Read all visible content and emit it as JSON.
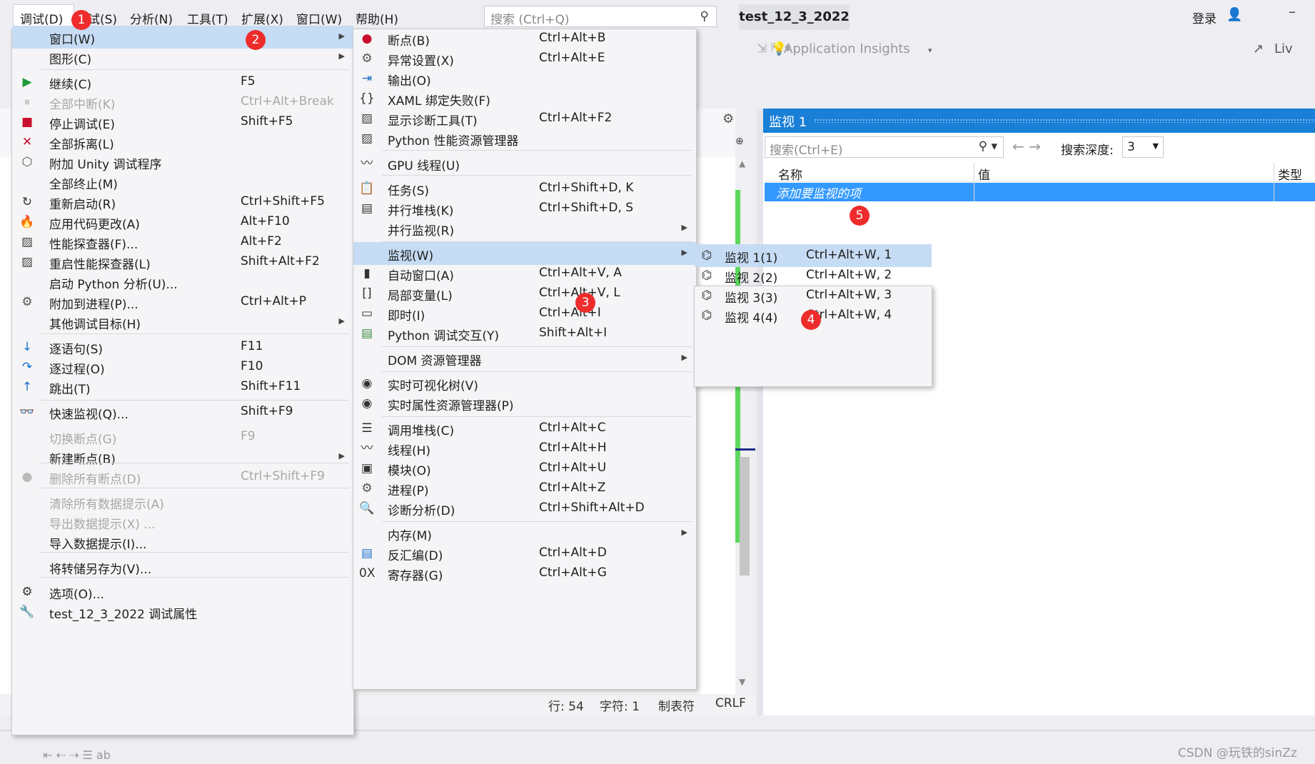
{
  "menubar": {
    "items": [
      "调试(D)",
      "测试(S)",
      "分析(N)",
      "工具(T)",
      "扩展(X)",
      "窗口(W)",
      "帮助(H)"
    ],
    "search_placeholder": "搜索 (Ctrl+Q)",
    "project": "test_12_3_2022",
    "login": "登录"
  },
  "toolbar": {
    "app_insights": "Application Insights",
    "live": "Liv"
  },
  "debug_menu": [
    {
      "label": "窗口(W)",
      "shortcut": "",
      "submenu": true,
      "highlight": true,
      "icon": ""
    },
    {
      "label": "图形(C)",
      "shortcut": "",
      "submenu": true,
      "icon": ""
    },
    {
      "label": "继续(C)",
      "shortcut": "F5",
      "icon": "play-icon"
    },
    {
      "label": "全部中断(K)",
      "shortcut": "Ctrl+Alt+Break",
      "disabled": true,
      "icon": "pause-icon"
    },
    {
      "label": "停止调试(E)",
      "shortcut": "Shift+F5",
      "icon": "stop-icon"
    },
    {
      "label": "全部拆离(L)",
      "shortcut": "",
      "icon": "detach-icon"
    },
    {
      "label": "附加 Unity 调试程序",
      "shortcut": "",
      "icon": "unity-icon"
    },
    {
      "label": "全部终止(M)",
      "shortcut": "",
      "icon": ""
    },
    {
      "label": "重新启动(R)",
      "shortcut": "Ctrl+Shift+F5",
      "icon": "restart-icon"
    },
    {
      "label": "应用代码更改(A)",
      "shortcut": "Alt+F10",
      "icon": "flame-icon"
    },
    {
      "label": "性能探查器(F)...",
      "shortcut": "Alt+F2",
      "icon": "profiler-icon"
    },
    {
      "label": "重启性能探查器(L)",
      "shortcut": "Shift+Alt+F2",
      "icon": "profiler-icon"
    },
    {
      "label": "启动 Python 分析(U)...",
      "shortcut": "",
      "icon": ""
    },
    {
      "label": "附加到进程(P)...",
      "shortcut": "Ctrl+Alt+P",
      "icon": "gears-icon"
    },
    {
      "label": "其他调试目标(H)",
      "shortcut": "",
      "submenu": true,
      "icon": ""
    },
    {
      "label": "逐语句(S)",
      "shortcut": "F11",
      "icon": "step-into-icon"
    },
    {
      "label": "逐过程(O)",
      "shortcut": "F10",
      "icon": "step-over-icon"
    },
    {
      "label": "跳出(T)",
      "shortcut": "Shift+F11",
      "icon": "step-out-icon"
    },
    {
      "label": "快速监视(Q)...",
      "shortcut": "Shift+F9",
      "icon": "glasses-icon"
    },
    {
      "label": "切换断点(G)",
      "shortcut": "F9",
      "disabled": true,
      "icon": ""
    },
    {
      "label": "新建断点(B)",
      "shortcut": "",
      "submenu": true,
      "icon": ""
    },
    {
      "label": "删除所有断点(D)",
      "shortcut": "Ctrl+Shift+F9",
      "disabled": true,
      "icon": "delete-breakpoints-icon"
    },
    {
      "label": "清除所有数据提示(A)",
      "shortcut": "",
      "disabled": true,
      "icon": ""
    },
    {
      "label": "导出数据提示(X) ...",
      "shortcut": "",
      "disabled": true,
      "icon": ""
    },
    {
      "label": "导入数据提示(I)...",
      "shortcut": "",
      "icon": ""
    },
    {
      "label": "将转储另存为(V)...",
      "shortcut": "",
      "icon": ""
    },
    {
      "label": "选项(O)...",
      "shortcut": "",
      "icon": "gear-icon"
    },
    {
      "label": "test_12_3_2022 调试属性",
      "shortcut": "",
      "icon": "wrench-icon"
    }
  ],
  "window_menu": [
    {
      "label": "断点(B)",
      "shortcut": "Ctrl+Alt+B",
      "icon": "breakpoint-icon"
    },
    {
      "label": "异常设置(X)",
      "shortcut": "Ctrl+Alt+E",
      "icon": "exception-icon"
    },
    {
      "label": "输出(O)",
      "shortcut": "",
      "icon": "output-icon"
    },
    {
      "label": "XAML 绑定失败(F)",
      "shortcut": "",
      "icon": "xaml-icon"
    },
    {
      "label": "显示诊断工具(T)",
      "shortcut": "Ctrl+Alt+F2",
      "icon": "diagnostics-icon"
    },
    {
      "label": "Python 性能资源管理器",
      "shortcut": "",
      "icon": "diagnostics-icon"
    },
    {
      "label": "GPU 线程(U)",
      "shortcut": "",
      "icon": "threads-icon"
    },
    {
      "label": "任务(S)",
      "shortcut": "Ctrl+Shift+D, K",
      "icon": "clipboard-icon"
    },
    {
      "label": "并行堆栈(K)",
      "shortcut": "Ctrl+Shift+D, S",
      "icon": "parallel-stacks-icon"
    },
    {
      "label": "并行监视(R)",
      "shortcut": "",
      "submenu": true,
      "icon": ""
    },
    {
      "label": "监视(W)",
      "shortcut": "",
      "submenu": true,
      "highlight": true,
      "icon": ""
    },
    {
      "label": "自动窗口(A)",
      "shortcut": "Ctrl+Alt+V, A",
      "icon": "autos-icon"
    },
    {
      "label": "局部变量(L)",
      "shortcut": "Ctrl+Alt+V, L",
      "icon": "locals-icon"
    },
    {
      "label": "即时(I)",
      "shortcut": "Ctrl+Alt+I",
      "icon": "immediate-icon"
    },
    {
      "label": "Python 调试交互(Y)",
      "shortcut": "Shift+Alt+I",
      "icon": "python-icon"
    },
    {
      "label": "DOM 资源管理器",
      "shortcut": "",
      "submenu": true,
      "icon": ""
    },
    {
      "label": "实时可视化树(V)",
      "shortcut": "",
      "icon": "camera-icon"
    },
    {
      "label": "实时属性资源管理器(P)",
      "shortcut": "",
      "icon": "camera-icon"
    },
    {
      "label": "调用堆栈(C)",
      "shortcut": "Ctrl+Alt+C",
      "icon": "call-stack-icon"
    },
    {
      "label": "线程(H)",
      "shortcut": "Ctrl+Alt+H",
      "icon": "threads-icon"
    },
    {
      "label": "模块(O)",
      "shortcut": "Ctrl+Alt+U",
      "icon": "modules-icon"
    },
    {
      "label": "进程(P)",
      "shortcut": "Ctrl+Alt+Z",
      "icon": "gears-icon"
    },
    {
      "label": "诊断分析(D)",
      "shortcut": "Ctrl+Shift+Alt+D",
      "icon": "analysis-icon"
    },
    {
      "label": "内存(M)",
      "shortcut": "",
      "submenu": true,
      "icon": ""
    },
    {
      "label": "反汇编(D)",
      "shortcut": "Ctrl+Alt+D",
      "icon": "disassembly-icon"
    },
    {
      "label": "寄存器(G)",
      "shortcut": "Ctrl+Alt+G",
      "icon": "registers-icon"
    }
  ],
  "watch_menu": [
    {
      "label": "监视 1(1)",
      "shortcut": "Ctrl+Alt+W, 1",
      "highlight": true
    },
    {
      "label": "监视 2(2)",
      "shortcut": "Ctrl+Alt+W, 2"
    },
    {
      "label": "监视 3(3)",
      "shortcut": "Ctrl+Alt+W, 3"
    },
    {
      "label": "监视 4(4)",
      "shortcut": "Ctrl+Alt+W, 4"
    }
  ],
  "watch_panel": {
    "title": "监视 1",
    "search_placeholder": "搜索(Ctrl+E)",
    "depth_label": "搜索深度:",
    "depth_value": "3",
    "col_name": "名称",
    "col_value": "值",
    "col_type": "类型",
    "add_item": "添加要监视的项"
  },
  "status": {
    "line": "行: 54",
    "char": "字符: 1",
    "tab": "制表符",
    "eol": "CRLF"
  },
  "badges": [
    "1",
    "2",
    "3",
    "4",
    "5"
  ],
  "watermark": "CSDN @玩铁的sinZz"
}
